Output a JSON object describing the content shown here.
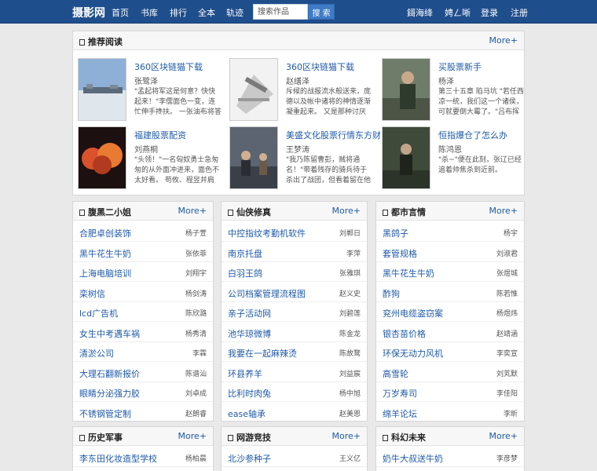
{
  "header": {
    "logo": "摄影网",
    "nav": [
      "首页",
      "书库",
      "排行",
      "全本",
      "轨迹"
    ],
    "search_placeholder": "搜索作品",
    "search_button": "搜 索",
    "right": [
      "鎶海绛",
      "娉ㄥ唽",
      "登录",
      "注册"
    ]
  },
  "recommend": {
    "title": "推荐阅读",
    "more": "More+",
    "items": [
      {
        "title": "360区块链猫下载",
        "author": "张鹭泽",
        "desc": "\"孟起将军这是何意？快快起来！\"李儒面色一变，连忙伸手搀扶。          一张油布将答帐"
      },
      {
        "title": "360区块链猫下载",
        "author": "赵缮泽",
        "desc": "斥候的战报流水般送来，庞德以及帐中诸将的神情逐渐凝重起来。         又是那种讨厌"
      },
      {
        "title": "买股票新手",
        "author": "杨泽",
        "desc": "第三十五章 陷马坑 \"若任西凉一统，我们这一个诸侯，可就要倒大霉了。\"吕布挥了挥"
      },
      {
        "title": "福建股票配资",
        "author": "刘燕桐",
        "desc": "\"头领！\"一名匈奴勇士急匆匆的从外面冲进来，面色不太好看。       苟攸、程昱并肩"
      },
      {
        "title": "美盛文化股票行情东方财",
        "author": "王梦涛",
        "desc": "\"我乃陈留曹彭，贼将通名！\"带着残存的骑兵待于杀出了战团，但看着留在他身边的"
      },
      {
        "title": "恒指爆仓了怎么办",
        "author": "陈鸿恩",
        "desc": "\"杀~\"便在此刻，张辽已经追着帅焦杀到近前。"
      }
    ]
  },
  "sections": [
    {
      "title": "腹黑二小姐",
      "more": "More+",
      "rows": [
        {
          "title": "合肥卓创装饰",
          "author": "杨子萱"
        },
        {
          "title": "黑牛花生牛奶",
          "author": "张依菲"
        },
        {
          "title": "上海电脑培训",
          "author": "刘翔宇"
        },
        {
          "title": "栾树信",
          "author": "杨剑涛"
        },
        {
          "title": "lcd广告机",
          "author": "陈欣潞"
        },
        {
          "title": "女生中考遇车祸",
          "author": "杨秀清"
        },
        {
          "title": "清淤公司",
          "author": "李霖"
        },
        {
          "title": "大理石翻新报价",
          "author": "陈谱汕"
        },
        {
          "title": "眼睛分泌强力胶",
          "author": "刘卓成"
        },
        {
          "title": "不锈钢管定制",
          "author": "赵朗睿"
        }
      ]
    },
    {
      "title": "仙侠修真",
      "more": "More+",
      "rows": [
        {
          "title": "中控指纹考勤机软件",
          "author": "刘郸日"
        },
        {
          "title": "南京托盘",
          "author": "李萍"
        },
        {
          "title": "白羽王鸽",
          "author": "张雅琪"
        },
        {
          "title": "公司档案管理流程图",
          "author": "赵义史"
        },
        {
          "title": "亲子活动网",
          "author": "刘碧莲"
        },
        {
          "title": "池华琼微博",
          "author": "陈金龙"
        },
        {
          "title": "我要在一起麻辣烫",
          "author": "陈故鹜"
        },
        {
          "title": "环县养羊",
          "author": "刘益宸"
        },
        {
          "title": "比利时肉兔",
          "author": "杨中旭"
        },
        {
          "title": "ease轴承",
          "author": "赵美恩"
        }
      ]
    },
    {
      "title": "都市言情",
      "more": "More+",
      "rows": [
        {
          "title": "黑鸽子",
          "author": "杨宇"
        },
        {
          "title": "套管规格",
          "author": "刘淑君"
        },
        {
          "title": "黑牛花生牛奶",
          "author": "张煜城"
        },
        {
          "title": "酢狗",
          "author": "陈若惟"
        },
        {
          "title": "兖州电缆盗窃案",
          "author": "杨煜炜"
        },
        {
          "title": "银杏苗价格",
          "author": "赵靖涵"
        },
        {
          "title": "环保无动力风机",
          "author": "李奕宣"
        },
        {
          "title": "高雪轮",
          "author": "刘芄默"
        },
        {
          "title": "万岁寿司",
          "author": "李佳阳"
        },
        {
          "title": "绵羊论坛",
          "author": "李昕"
        }
      ]
    },
    {
      "title": "历史军事",
      "more": "More+",
      "rows": [
        {
          "title": "李东田化妆造型学校",
          "author": "杨柏晨"
        }
      ]
    },
    {
      "title": "网游竞技",
      "more": "More+",
      "rows": [
        {
          "title": "北沙参种子",
          "author": "王义亿"
        }
      ]
    },
    {
      "title": "科幻未来",
      "more": "More+",
      "rows": [
        {
          "title": "奶牛大叔送牛奶",
          "author": "李彦梦"
        }
      ]
    }
  ]
}
